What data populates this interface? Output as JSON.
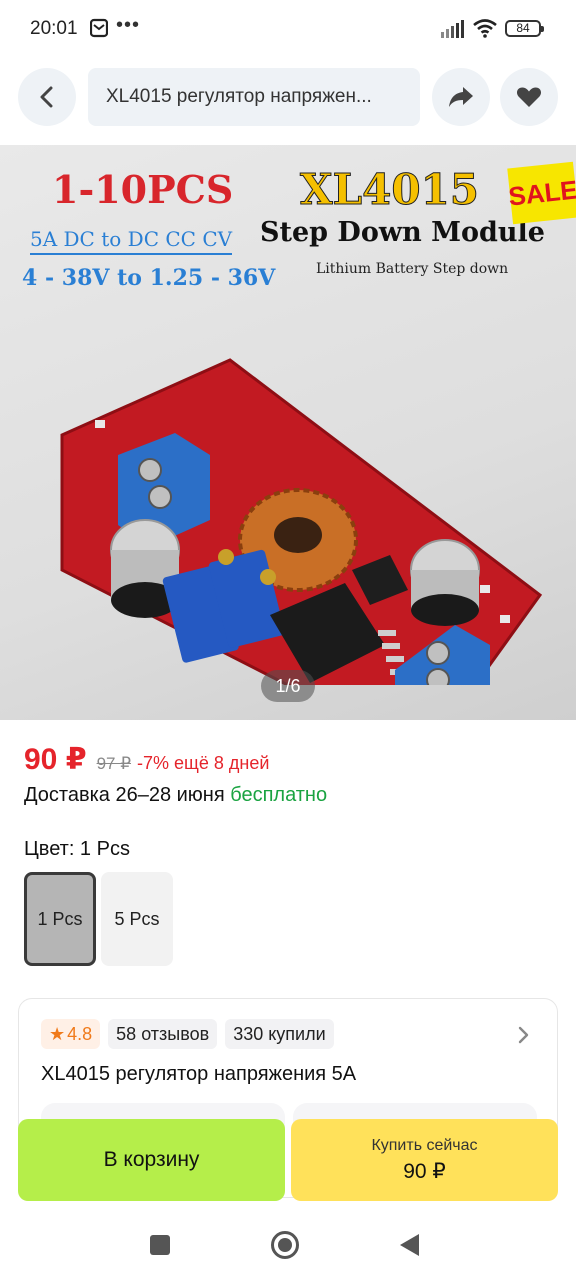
{
  "status_bar": {
    "time": "20:01",
    "dots": "•••",
    "battery": "84",
    "icons": [
      "message-icon",
      "signal-icon",
      "wifi-icon",
      "battery-icon"
    ]
  },
  "top_bar": {
    "search_text": "XL4015 регулятор напряжен...",
    "icons": [
      "chevron-left-icon",
      "share-icon",
      "heart-icon"
    ]
  },
  "product_image": {
    "promo_qty": "1-10PCS",
    "line1": "5A DC to DC CC CV",
    "line2": "4 - 38V to 1.25 - 36V",
    "model": "XL4015",
    "subtitle": "Step Down Module",
    "caption": "Lithium Battery Step down",
    "sale_badge": "SALE",
    "counter": "1/6"
  },
  "price": {
    "current": "90 ₽",
    "old": "97 ₽",
    "discount": "-7% ещё 8 дней"
  },
  "delivery": {
    "text": "Доставка 26–28 июня",
    "free": "бесплатно"
  },
  "color": {
    "label": "Цвет: 1 Pcs",
    "options": [
      "1 Pcs",
      "5 Pcs"
    ],
    "selected": "1 Pcs"
  },
  "info_card": {
    "rating": "4.8",
    "reviews": "58 отзывов",
    "bought": "330 купили",
    "title": "XL4015 регулятор напряжения 5A"
  },
  "actions": {
    "cart_label": "В корзину",
    "buy_label": "Купить сейчас",
    "buy_price": "90 ₽"
  },
  "colors": {
    "price_red": "#e5242b",
    "free_green": "#1aa341",
    "cart_green": "#b5ee4a",
    "buy_yellow": "#ffe15a",
    "rating_orange": "#f07a1a"
  }
}
